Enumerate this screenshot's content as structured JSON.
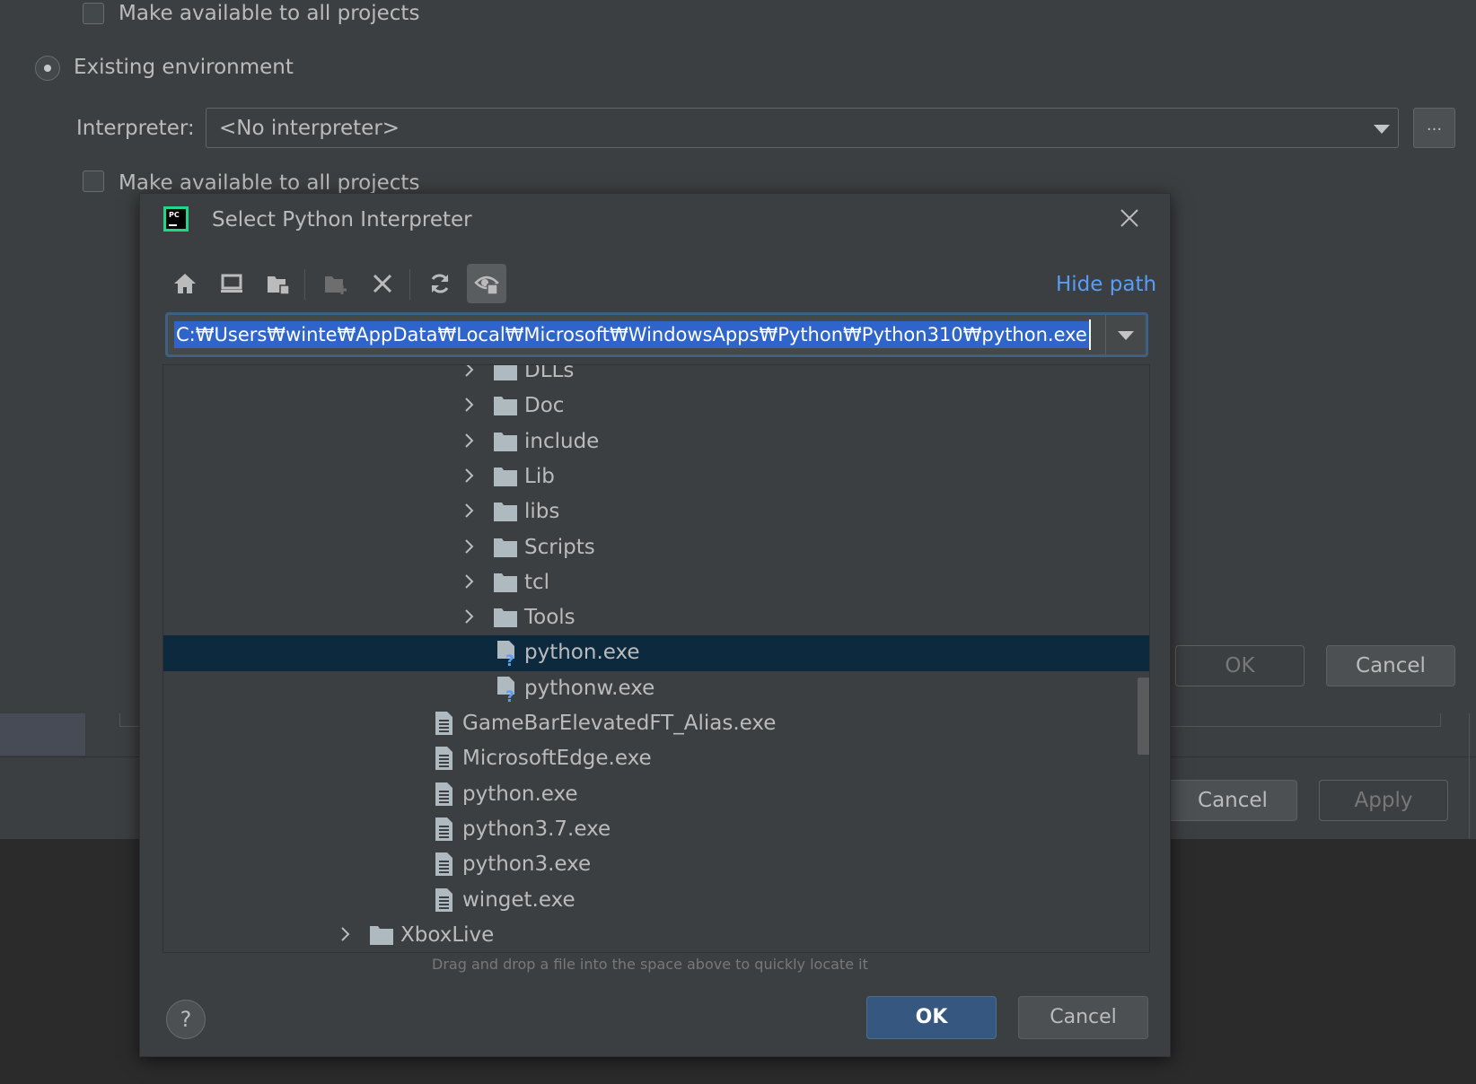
{
  "background": {
    "top_checkbox_label": "Make available to all projects",
    "existing_env_label": "Existing environment",
    "interpreter_label": "Interpreter:",
    "interpreter_value": "<No interpreter>",
    "browse_button": "...",
    "checkbox_label": "Make available to all projects",
    "ok_button": "OK",
    "cancel_button": "Cancel",
    "cancel_button_2": "Cancel",
    "apply_button": "Apply"
  },
  "dialog": {
    "title": "Select Python Interpreter",
    "toolbar": {
      "icons": [
        "home-icon",
        "desktop-icon",
        "project-folder-icon",
        "new-folder-icon",
        "delete-icon",
        "refresh-icon",
        "show-hidden-icon"
      ]
    },
    "hide_path_label": "Hide path",
    "path_value": "C:₩Users₩winte₩AppData₩Local₩Microsoft₩WindowsApps₩Python₩Python310₩python.exe",
    "tree": [
      {
        "label": "DLLs",
        "type": "folder",
        "level": 2,
        "expandable": true
      },
      {
        "label": "Doc",
        "type": "folder",
        "level": 2,
        "expandable": true
      },
      {
        "label": "include",
        "type": "folder",
        "level": 2,
        "expandable": true
      },
      {
        "label": "Lib",
        "type": "folder",
        "level": 2,
        "expandable": true
      },
      {
        "label": "libs",
        "type": "folder",
        "level": 2,
        "expandable": true
      },
      {
        "label": "Scripts",
        "type": "folder",
        "level": 2,
        "expandable": true
      },
      {
        "label": "tcl",
        "type": "folder",
        "level": 2,
        "expandable": true
      },
      {
        "label": "Tools",
        "type": "folder",
        "level": 2,
        "expandable": true
      },
      {
        "label": "python.exe",
        "type": "unknown-file",
        "level": 2,
        "expandable": false,
        "selected": true
      },
      {
        "label": "pythonw.exe",
        "type": "unknown-file",
        "level": 2,
        "expandable": false
      },
      {
        "label": "GameBarElevatedFT_Alias.exe",
        "type": "file",
        "level": 1,
        "expandable": false
      },
      {
        "label": "MicrosoftEdge.exe",
        "type": "file",
        "level": 1,
        "expandable": false
      },
      {
        "label": "python.exe",
        "type": "file",
        "level": 1,
        "expandable": false
      },
      {
        "label": "python3.7.exe",
        "type": "file",
        "level": 1,
        "expandable": false
      },
      {
        "label": "python3.exe",
        "type": "file",
        "level": 1,
        "expandable": false
      },
      {
        "label": "winget.exe",
        "type": "file",
        "level": 1,
        "expandable": false
      },
      {
        "label": "XboxLive",
        "type": "folder",
        "level": 0,
        "expandable": true
      }
    ],
    "hint": "Drag and drop a file into the space above to quickly locate it",
    "help_label": "?",
    "ok_button": "OK",
    "cancel_button": "Cancel"
  },
  "colors": {
    "accent": "#589df6",
    "selection_row": "#0d293e",
    "path_selection": "#2f65ca",
    "ok_button": "#365880"
  }
}
